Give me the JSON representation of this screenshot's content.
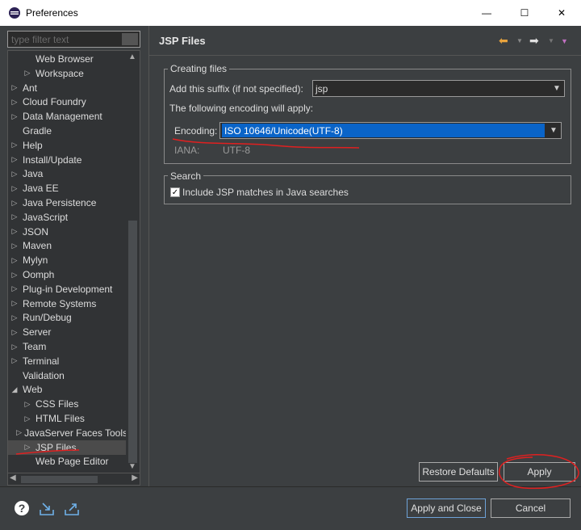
{
  "window": {
    "title": "Preferences",
    "minimize_glyph": "—",
    "maximize_glyph": "☐",
    "close_glyph": "✕"
  },
  "filter": {
    "placeholder": "type filter text"
  },
  "tree": [
    {
      "label": "Web Browser",
      "indent": 1,
      "arrow": ""
    },
    {
      "label": "Workspace",
      "indent": 1,
      "arrow": "▷"
    },
    {
      "label": "Ant",
      "indent": 0,
      "arrow": "▷"
    },
    {
      "label": "Cloud Foundry",
      "indent": 0,
      "arrow": "▷"
    },
    {
      "label": "Data Management",
      "indent": 0,
      "arrow": "▷"
    },
    {
      "label": "Gradle",
      "indent": 0,
      "arrow": ""
    },
    {
      "label": "Help",
      "indent": 0,
      "arrow": "▷"
    },
    {
      "label": "Install/Update",
      "indent": 0,
      "arrow": "▷"
    },
    {
      "label": "Java",
      "indent": 0,
      "arrow": "▷"
    },
    {
      "label": "Java EE",
      "indent": 0,
      "arrow": "▷"
    },
    {
      "label": "Java Persistence",
      "indent": 0,
      "arrow": "▷"
    },
    {
      "label": "JavaScript",
      "indent": 0,
      "arrow": "▷"
    },
    {
      "label": "JSON",
      "indent": 0,
      "arrow": "▷"
    },
    {
      "label": "Maven",
      "indent": 0,
      "arrow": "▷"
    },
    {
      "label": "Mylyn",
      "indent": 0,
      "arrow": "▷"
    },
    {
      "label": "Oomph",
      "indent": 0,
      "arrow": "▷"
    },
    {
      "label": "Plug-in Development",
      "indent": 0,
      "arrow": "▷"
    },
    {
      "label": "Remote Systems",
      "indent": 0,
      "arrow": "▷"
    },
    {
      "label": "Run/Debug",
      "indent": 0,
      "arrow": "▷"
    },
    {
      "label": "Server",
      "indent": 0,
      "arrow": "▷"
    },
    {
      "label": "Team",
      "indent": 0,
      "arrow": "▷"
    },
    {
      "label": "Terminal",
      "indent": 0,
      "arrow": "▷"
    },
    {
      "label": "Validation",
      "indent": 0,
      "arrow": ""
    },
    {
      "label": "Web",
      "indent": 0,
      "arrow": "◢"
    },
    {
      "label": "CSS Files",
      "indent": 1,
      "arrow": "▷"
    },
    {
      "label": "HTML Files",
      "indent": 1,
      "arrow": "▷"
    },
    {
      "label": "JavaServer Faces Tools",
      "indent": 1,
      "arrow": "▷"
    },
    {
      "label": "JSP Files",
      "indent": 1,
      "arrow": "▷",
      "selected": true
    },
    {
      "label": "Web Page Editor",
      "indent": 1,
      "arrow": ""
    }
  ],
  "page": {
    "title": "JSP Files",
    "creating_files": {
      "legend": "Creating files",
      "suffix_label": "Add this suffix (if not specified):",
      "suffix_value": "jsp",
      "encoding_note": "The following encoding will apply:",
      "encoding_label": "Encoding:",
      "encoding_value": "ISO 10646/Unicode(UTF-8)",
      "iana_label": "IANA:",
      "iana_value": "UTF-8"
    },
    "search": {
      "legend": "Search",
      "include_label": "Include JSP matches in Java searches",
      "include_checked": true
    },
    "restore_defaults": "Restore Defaults",
    "apply": "Apply"
  },
  "footer": {
    "apply_and_close": "Apply and Close",
    "cancel": "Cancel"
  },
  "icons": {
    "help": "help-icon",
    "import": "import-icon",
    "export": "export-icon",
    "back": "back-arrow-icon",
    "forward": "forward-arrow-icon",
    "menu": "view-menu-icon"
  },
  "colors": {
    "background": "#3c3f41",
    "selection": "#0a64c8",
    "annotation": "#e02020",
    "back_arrow": "#e8a33d"
  }
}
